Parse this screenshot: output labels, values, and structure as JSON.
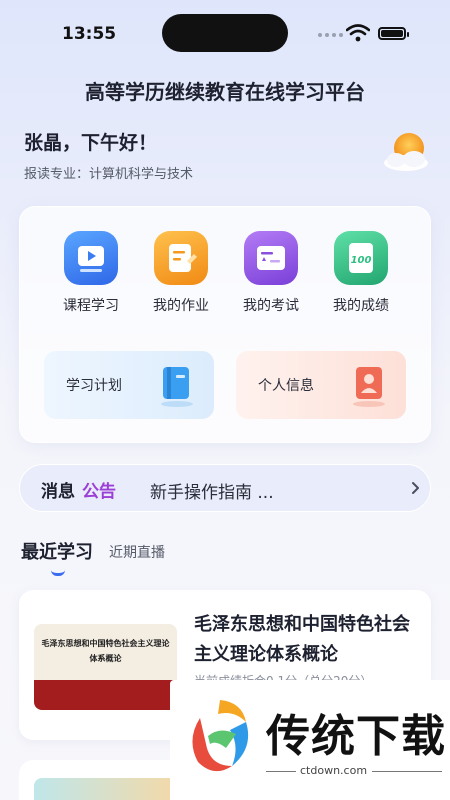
{
  "status_bar": {
    "time": "13:55"
  },
  "header": {
    "title": "高等学历继续教育在线学习平台"
  },
  "user": {
    "greeting": "张晶，下午好！",
    "major": "报读专业：计算机科学与技术"
  },
  "quick_actions": [
    {
      "label": "课程学习",
      "icon": "play-icon",
      "color": "#3b7df2"
    },
    {
      "label": "我的作业",
      "icon": "edit-icon",
      "color": "#f59a1f"
    },
    {
      "label": "我的考试",
      "icon": "exam-icon",
      "color": "#8a4fe0"
    },
    {
      "label": "我的成绩",
      "icon": "score-100-icon",
      "color": "#2fbf82"
    }
  ],
  "cards": {
    "plan": {
      "label": "学习计划",
      "icon": "book-icon",
      "color": "#3a9ff0"
    },
    "profile": {
      "label": "个人信息",
      "icon": "id-card-icon",
      "color": "#f06b55"
    }
  },
  "notice": {
    "label_1": "消息",
    "label_2": "公告",
    "text": "新手操作指南 ..."
  },
  "tabs": {
    "active": "最近学习",
    "inactive": "近期直播"
  },
  "course": {
    "thumb_title": "毛泽东思想和中国特色社会主义理论体系概论",
    "title": "毛泽东思想和中国特色社会主义理论体系概论",
    "subtitle": "当前成绩折合0.1分（总分20分）"
  },
  "watermark": {
    "brand": "传统下载",
    "url": "ctdown.com"
  },
  "colors": {
    "accent": "#3b6cf0",
    "notice_purple": "#9b3fd6",
    "thumb_red": "#a31c1e"
  }
}
